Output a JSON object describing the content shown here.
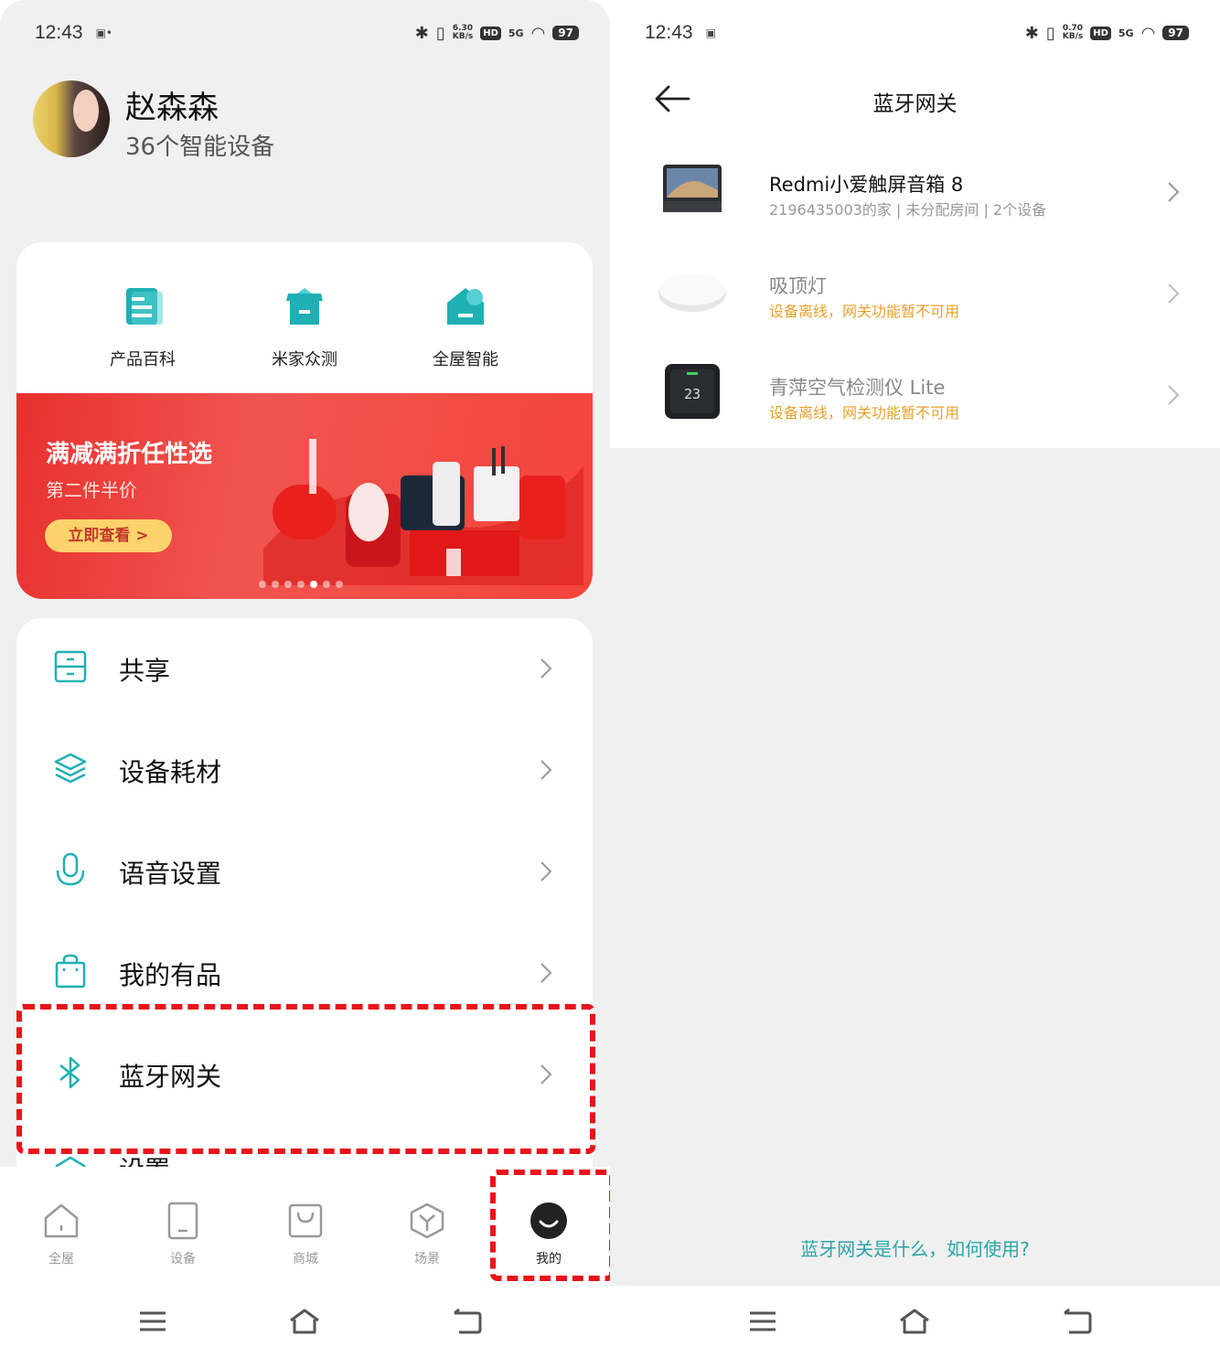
{
  "left": {
    "status": {
      "time": "12:43",
      "speed_top": "6.30",
      "speed_bottom": "KB/s",
      "hd": "HD",
      "net": "5G",
      "battery": "97"
    },
    "profile": {
      "name": "赵森森",
      "device_count": "36个智能设备"
    },
    "quick_actions": [
      {
        "label": "产品百科",
        "icon": "document-icon"
      },
      {
        "label": "米家众测",
        "icon": "gift-box-icon"
      },
      {
        "label": "全屋智能",
        "icon": "smart-home-icon"
      }
    ],
    "banner": {
      "title": "满减满折任性选",
      "subtitle": "第二件半价",
      "button": "立即查看 >"
    },
    "menu": [
      {
        "label": "共享",
        "icon": "share-cabinet-icon"
      },
      {
        "label": "设备耗材",
        "icon": "layers-icon"
      },
      {
        "label": "语音设置",
        "icon": "microphone-icon"
      },
      {
        "label": "我的有品",
        "icon": "shopping-bag-icon"
      },
      {
        "label": "蓝牙网关",
        "icon": "bluetooth-icon"
      },
      {
        "label": "设置",
        "icon": "settings-icon"
      }
    ],
    "tabs": [
      {
        "label": "全屋",
        "icon": "house-icon"
      },
      {
        "label": "设备",
        "icon": "device-icon"
      },
      {
        "label": "商城",
        "icon": "shop-bag-icon"
      },
      {
        "label": "场景",
        "icon": "scene-cube-icon"
      },
      {
        "label": "我的",
        "icon": "profile-face-icon"
      }
    ],
    "accent": "#1fb0b4",
    "highlight_color": "#e8141b"
  },
  "right": {
    "status": {
      "time": "12:43",
      "speed_top": "0.70",
      "speed_bottom": "KB/s",
      "hd": "HD",
      "net": "5G",
      "battery": "97"
    },
    "header": {
      "title": "蓝牙网关"
    },
    "devices": [
      {
        "name": "Redmi小爱触屏音箱 8",
        "sub": "2196435003的家 | 未分配房间 | 2个设备",
        "online": true,
        "icon": "smart-display-icon"
      },
      {
        "name": "吸顶灯",
        "sub": "设备离线，网关功能暂不可用",
        "online": false,
        "icon": "ceiling-light-icon"
      },
      {
        "name": "青萍空气检测仪 Lite",
        "sub": "设备离线，网关功能暂不可用",
        "online": false,
        "icon": "air-monitor-icon"
      }
    ],
    "help_link": "蓝牙网关是什么，如何使用?",
    "warn_color": "#e9a02a",
    "link_color": "#2aa5a8"
  }
}
